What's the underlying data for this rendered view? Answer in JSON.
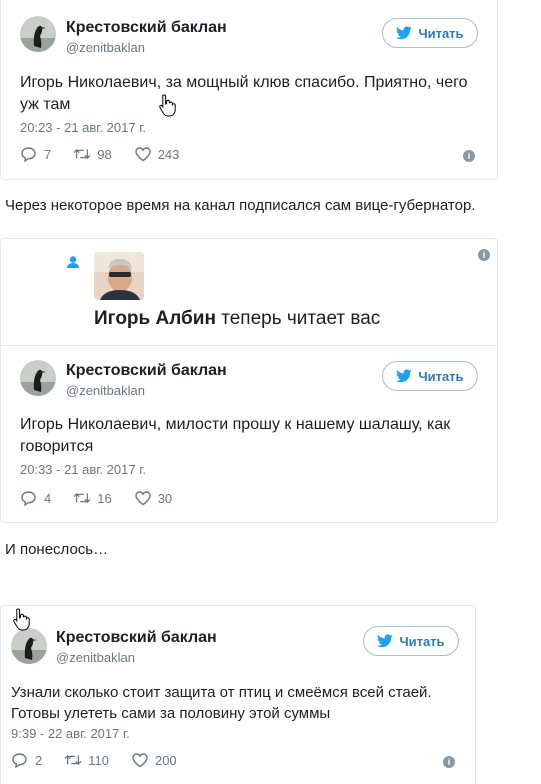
{
  "tweet1": {
    "author_name": "Крестовский баклан",
    "author_handle": "@zenitbaklan",
    "follow_label": "Читать",
    "text_line1": "Игорь Николаевич, за мощный клюв спасибо. Приятно, чего",
    "text_line2": "уж там",
    "timestamp": "20:23 - 21 авг. 2017 г.",
    "replies": "7",
    "retweets": "98",
    "likes": "243"
  },
  "caption1": "Через некоторое время на канал подписался сам вице-губернатор.",
  "notification": {
    "follower_name": "Игорь Албин",
    "follow_text": "теперь читает вас"
  },
  "tweet2": {
    "author_name": "Крестовский баклан",
    "author_handle": "@zenitbaklan",
    "follow_label": "Читать",
    "text_line1": "Игорь Николаевич, милости прошу к нашему шалашу, как",
    "text_line2": "говорится",
    "timestamp": "20:33 - 21 авг. 2017 г.",
    "replies": "4",
    "retweets": "16",
    "likes": "30"
  },
  "caption2": "И понеслось…",
  "tweet3": {
    "author_name": "Крестовский баклан",
    "author_handle": "@zenitbaklan",
    "follow_label": "Читать",
    "text_line1": "Узнали сколько стоит защита от птиц и смеёмся всей стаей.",
    "text_line2": "Готовы улететь сами за половину этой суммы",
    "timestamp": "9:39 - 22 авг. 2017 г.",
    "replies": "2",
    "retweets": "110",
    "likes": "200"
  },
  "colors": {
    "twitter_blue": "#1da1f2",
    "text": "#1c2022",
    "muted": "#697882",
    "border": "#e1e8ed"
  }
}
